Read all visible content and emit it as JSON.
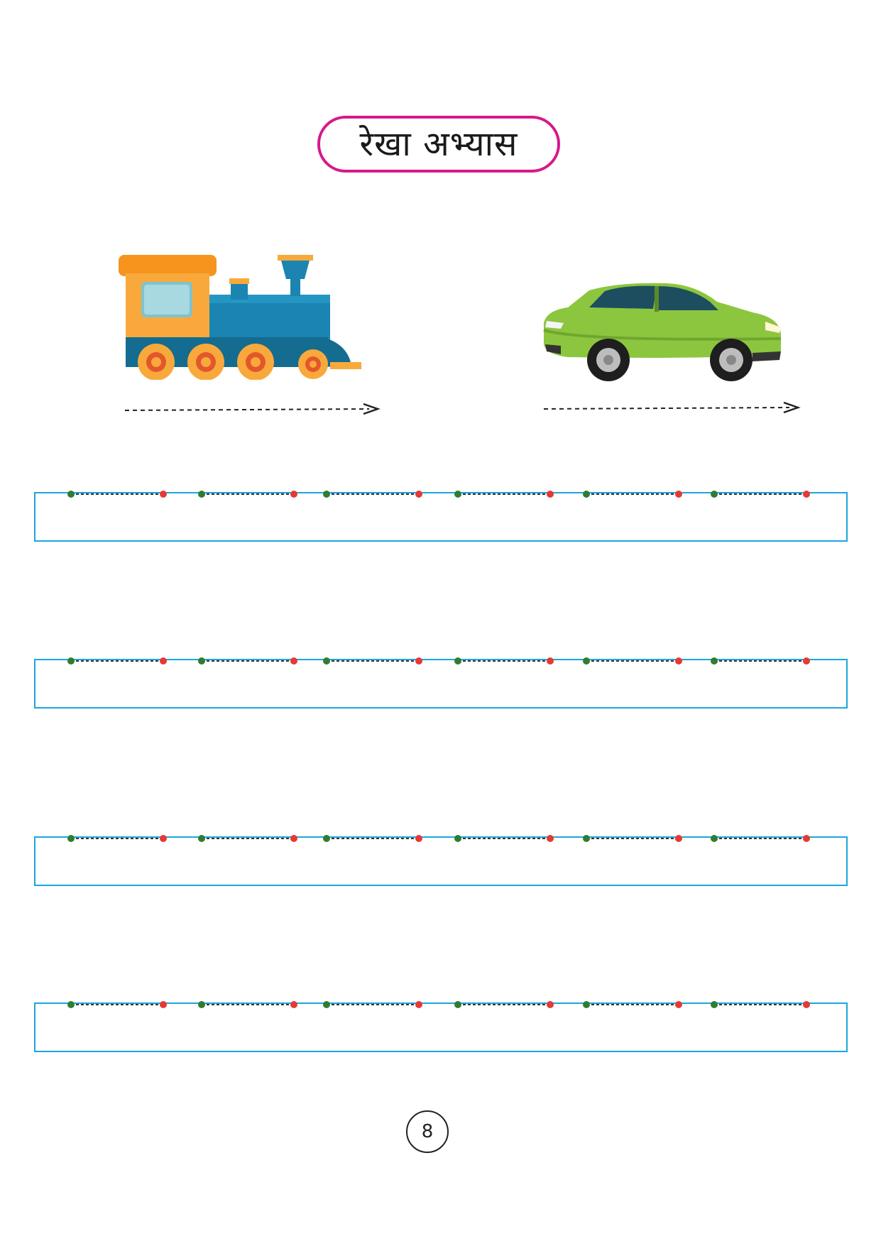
{
  "title": "रेखा अभ्यास",
  "page_number": "8",
  "illustrations": [
    {
      "name": "train-icon",
      "direction": "left-to-right"
    },
    {
      "name": "car-icon",
      "direction": "left-to-right"
    }
  ],
  "trace_rows": {
    "count": 4,
    "pattern": [
      "green",
      "red",
      "green",
      "red",
      "green",
      "red",
      "green",
      "red",
      "green",
      "red",
      "green",
      "red"
    ]
  },
  "colors": {
    "title_border": "#d6198a",
    "box_border": "#1ba7de",
    "dot_start": "#2e7d32",
    "dot_end": "#e53935"
  }
}
